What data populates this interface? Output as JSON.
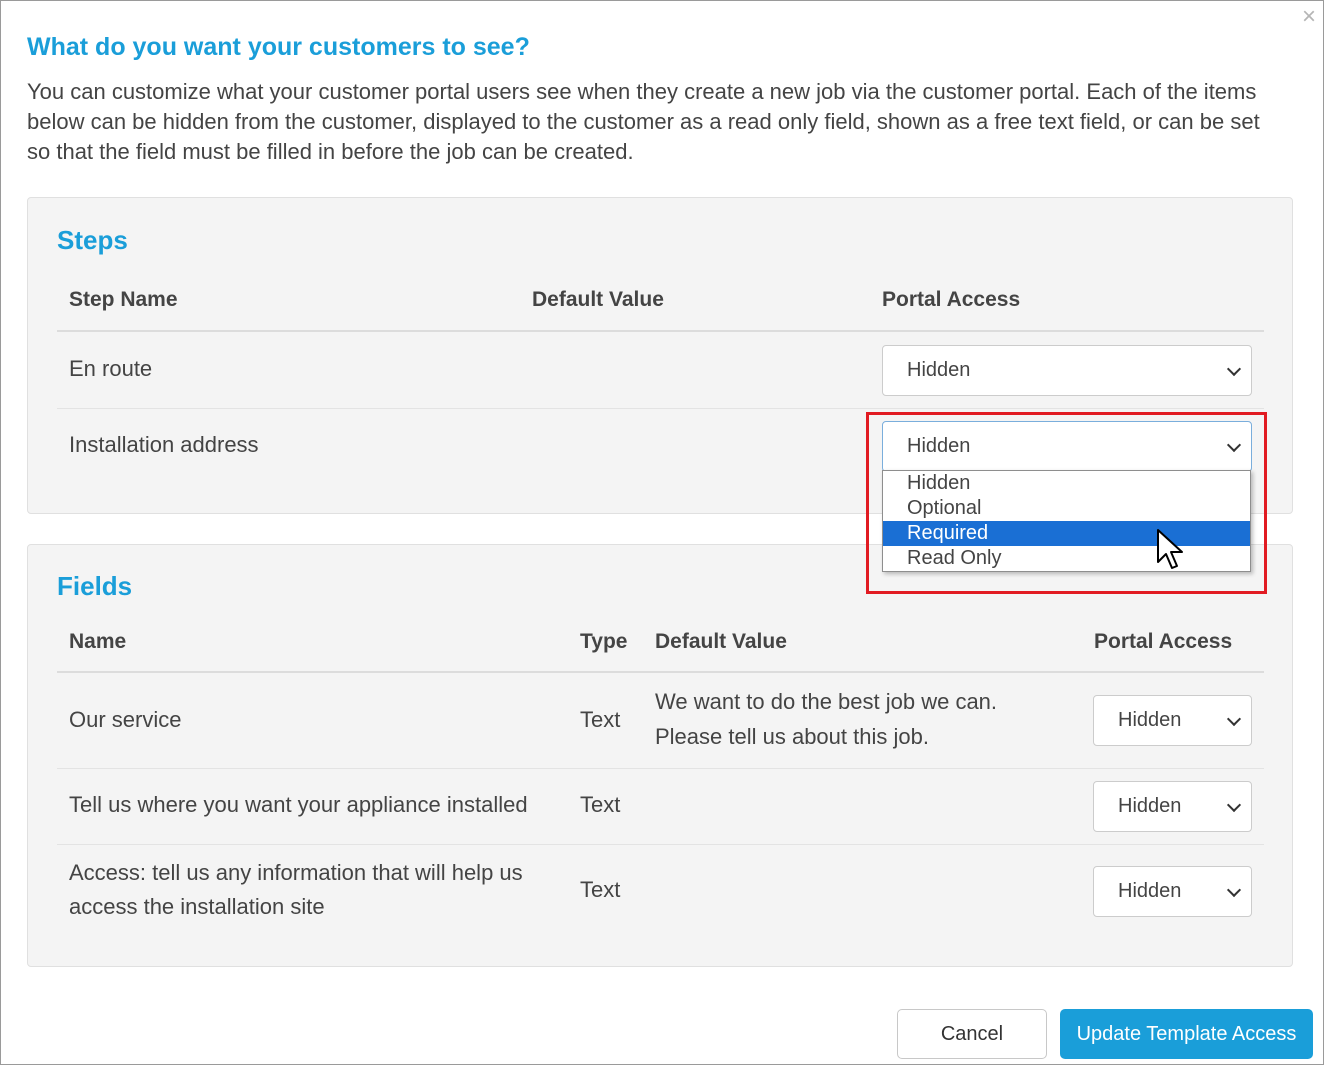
{
  "dialog": {
    "close_glyph": "×",
    "title": "What do you want your customers to see?",
    "description": "You can customize what your customer portal users see when they create a new job via the customer portal. Each of the items below can be hidden from the customer, displayed to the customer as a read only field, shown as a free text field, or can be set so that the field must be filled in before the job can be created."
  },
  "steps": {
    "title": "Steps",
    "columns": [
      "Step Name",
      "Default Value",
      "Portal Access"
    ],
    "rows": [
      {
        "name": "En route",
        "default_value": "",
        "access": "Hidden"
      },
      {
        "name": "Installation address",
        "default_value": "",
        "access": "Hidden"
      }
    ],
    "open_dropdown": {
      "options": [
        "Hidden",
        "Optional",
        "Required",
        "Read Only"
      ],
      "highlighted": "Required"
    }
  },
  "fields": {
    "title": "Fields",
    "columns": [
      "Name",
      "Type",
      "Default Value",
      "Portal Access"
    ],
    "rows": [
      {
        "name_lines": [
          "Our service"
        ],
        "type": "Text",
        "default_lines": [
          "We want to do the best job we can.",
          "Please tell us about this job."
        ],
        "access": "Hidden"
      },
      {
        "name_lines": [
          "Tell us where you want your appliance installed"
        ],
        "type": "Text",
        "default_lines": [],
        "access": "Hidden"
      },
      {
        "name_lines": [
          "Access: tell us any information that will help us",
          "access the installation site"
        ],
        "type": "Text",
        "default_lines": [],
        "access": "Hidden"
      }
    ]
  },
  "footer": {
    "cancel_label": "Cancel",
    "submit_label": "Update Template Access"
  },
  "colors": {
    "accent": "#1a9ed9",
    "highlight_border": "#e11b22",
    "selected_option": "#1a6fd4"
  },
  "icons": [
    "close-icon",
    "chevron-down-icon",
    "mouse-pointer-icon"
  ]
}
